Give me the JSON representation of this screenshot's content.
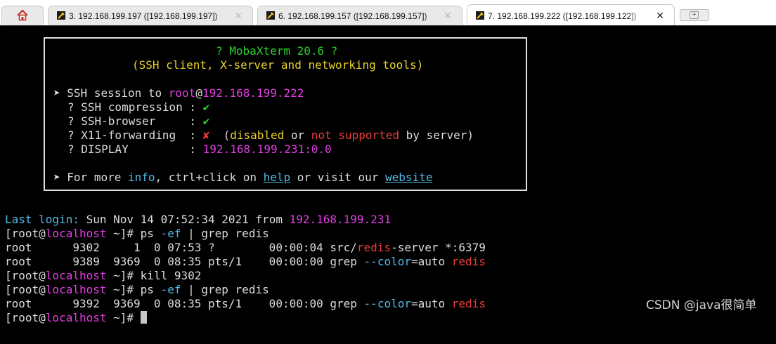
{
  "tabs": [
    {
      "number": "3.",
      "title": "192.168.199.197 ([192.168.199.197])",
      "close": "✕",
      "active": false
    },
    {
      "number": "6.",
      "title": "192.168.199.157 ([192.168.199.157])",
      "close": "✕",
      "active": false
    },
    {
      "number": "7.",
      "title": "192.168.199.222 ([192.168.199.122])",
      "close": "✕",
      "active": true
    }
  ],
  "banner": {
    "title": "? MobaXterm 20.6 ?",
    "subtitle": "(SSH client, X-server and networking tools)",
    "session_arrow": "➤",
    "session_label": "SSH session to ",
    "session_user": "root",
    "session_at": "@",
    "session_host": "192.168.199.222",
    "compression_label": "? SSH compression : ",
    "compression_val": "✔",
    "browser_label": "? SSH-browser     : ",
    "browser_val": "✔",
    "x11_label": "? X11-forwarding  : ",
    "x11_val": "✘",
    "x11_open": "  (",
    "x11_disabled": "disabled",
    "x11_or": " or ",
    "x11_not_supported": "not supported",
    "x11_by": " by server)",
    "display_label": "? DISPLAY         : ",
    "display_val": "192.168.199.231:0.0",
    "more_arrow": "➤",
    "more_1": "For more ",
    "more_info": "info",
    "more_2": ", ctrl+click on ",
    "more_help": "help",
    "more_3": " or visit our ",
    "more_website": "website"
  },
  "terminal": {
    "last_login_label": "Last login:",
    "last_login_text": " Sun Nov 14 07:52:34 2021 from ",
    "last_login_host": "192.168.199.231",
    "prompt_open": "[root@",
    "prompt_host": "localhost",
    "prompt_close": " ~]# ",
    "cmd1_a": "ps ",
    "cmd1_flag": "-ef",
    "cmd1_b": " | grep redis",
    "row1_a": "root      9302     1  0 07:53 ?        00:00:04 src/",
    "row1_redis": "redis",
    "row1_b": "-server *:6379",
    "row2_a": "root      9389  9369  0 08:35 pts/1    00:00:00 grep ",
    "row2_flag": "--color",
    "row2_b": "=auto ",
    "row2_redis": "redis",
    "cmd2": "kill 9302",
    "cmd3_a": "ps ",
    "cmd3_flag": "-ef",
    "cmd3_b": " | grep redis",
    "row3_a": "root      9392  9369  0 08:35 pts/1    00:00:00 grep ",
    "row3_flag": "--color",
    "row3_b": "=auto ",
    "row3_redis": "redis"
  },
  "watermark": "CSDN @java很简单"
}
